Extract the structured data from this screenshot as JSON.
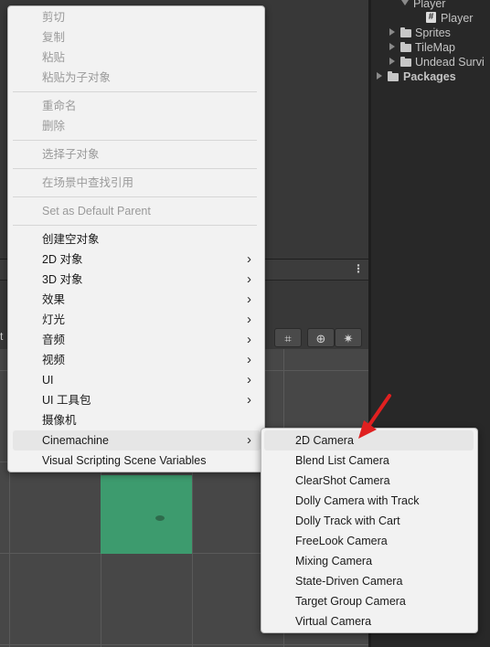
{
  "project_panel": {
    "items": [
      {
        "label": "Player"
      },
      {
        "label": "Player"
      },
      {
        "label": "Sprites"
      },
      {
        "label": "TileMap"
      },
      {
        "label": "Undead Survi"
      },
      {
        "label": "Packages"
      }
    ]
  },
  "scene": {
    "toolbar_cut_label": "t",
    "tools": [
      "⌗",
      "⊕",
      "✷"
    ]
  },
  "context_menu": {
    "items": [
      {
        "label": "剪切",
        "disabled": true
      },
      {
        "label": "复制",
        "disabled": true
      },
      {
        "label": "粘贴",
        "disabled": true
      },
      {
        "label": "粘贴为子对象",
        "disabled": true
      },
      {
        "label": "重命名",
        "disabled": true
      },
      {
        "label": "删除",
        "disabled": true
      },
      {
        "label": "选择子对象",
        "disabled": true
      },
      {
        "label": "在场景中查找引用",
        "disabled": true
      },
      {
        "label": "Set as Default Parent",
        "disabled": true
      },
      {
        "label": "创建空对象"
      },
      {
        "label": "2D 对象",
        "submenu": true
      },
      {
        "label": "3D 对象",
        "submenu": true
      },
      {
        "label": "效果",
        "submenu": true
      },
      {
        "label": "灯光",
        "submenu": true
      },
      {
        "label": "音频",
        "submenu": true
      },
      {
        "label": "视频",
        "submenu": true
      },
      {
        "label": "UI",
        "submenu": true
      },
      {
        "label": "UI 工具包",
        "submenu": true
      },
      {
        "label": "摄像机"
      },
      {
        "label": "Cinemachine",
        "submenu": true,
        "active": true
      },
      {
        "label": "Visual Scripting Scene Variables"
      }
    ],
    "arrow_glyph": "›"
  },
  "cinemachine_submenu": {
    "items": [
      {
        "label": "2D Camera",
        "active": true
      },
      {
        "label": "Blend List Camera"
      },
      {
        "label": "ClearShot Camera"
      },
      {
        "label": "Dolly Camera with Track"
      },
      {
        "label": "Dolly Track with Cart"
      },
      {
        "label": "FreeLook Camera"
      },
      {
        "label": "Mixing Camera"
      },
      {
        "label": "State-Driven Camera"
      },
      {
        "label": "Target Group Camera"
      },
      {
        "label": "Virtual Camera"
      }
    ]
  },
  "colors": {
    "editor_bg": "#383838",
    "menu_bg": "#f2f2f2",
    "sprite_green": "#3d9b6e",
    "annotation_red": "#e02020"
  }
}
